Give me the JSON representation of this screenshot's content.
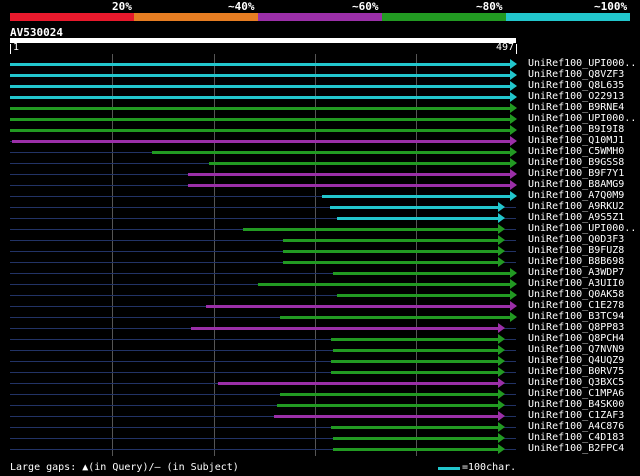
{
  "scale": {
    "labels": [
      "20%",
      "~40%",
      "~60%",
      "~80%",
      "~100%"
    ],
    "colors": [
      "#e8192c",
      "#e67d22",
      "#9b2fa8",
      "#229a22",
      "#22c6cc"
    ]
  },
  "query": {
    "name": "AV530024",
    "start": "1",
    "end": "497"
  },
  "hits": [
    {
      "name": "UniRef100_UPI000..",
      "color": "#22c6cc",
      "start": 1,
      "end": 497
    },
    {
      "name": "UniRef100_Q8VZF3",
      "color": "#22c6cc",
      "start": 1,
      "end": 497
    },
    {
      "name": "UniRef100_Q8L635",
      "color": "#22c6cc",
      "start": 1,
      "end": 497
    },
    {
      "name": "UniRef100_O22913",
      "color": "#22c6cc",
      "start": 1,
      "end": 497
    },
    {
      "name": "UniRef100_B9RNE4",
      "color": "#229a22",
      "start": 1,
      "end": 497
    },
    {
      "name": "UniRef100_UPI000..",
      "color": "#229a22",
      "start": 1,
      "end": 497
    },
    {
      "name": "UniRef100_B9I9I8",
      "color": "#229a22",
      "start": 1,
      "end": 497
    },
    {
      "name": "UniRef100_Q10MJ1",
      "color": "#9b2fa8",
      "start": 3,
      "end": 497
    },
    {
      "name": "UniRef100_C5WMH0",
      "color": "#229a22",
      "start": 140,
      "end": 497
    },
    {
      "name": "UniRef100_B9GSS8",
      "color": "#229a22",
      "start": 196,
      "end": 497
    },
    {
      "name": "UniRef100_B9F7Y1",
      "color": "#9b2fa8",
      "start": 175,
      "end": 497
    },
    {
      "name": "UniRef100_B8AMG9",
      "color": "#9b2fa8",
      "start": 175,
      "end": 497
    },
    {
      "name": "UniRef100_A7Q0M9",
      "color": "#22c6cc",
      "start": 307,
      "end": 497
    },
    {
      "name": "UniRef100_A9RKU2",
      "color": "#22c6cc",
      "start": 315,
      "end": 485
    },
    {
      "name": "UniRef100_A9S5Z1",
      "color": "#22c6cc",
      "start": 322,
      "end": 485
    },
    {
      "name": "UniRef100_UPI000..",
      "color": "#229a22",
      "start": 229,
      "end": 485
    },
    {
      "name": "UniRef100_Q0D3F3",
      "color": "#229a22",
      "start": 269,
      "end": 485
    },
    {
      "name": "UniRef100_B9FUZ8",
      "color": "#229a22",
      "start": 269,
      "end": 485
    },
    {
      "name": "UniRef100_B8B698",
      "color": "#229a22",
      "start": 269,
      "end": 485
    },
    {
      "name": "UniRef100_A3WDP7",
      "color": "#229a22",
      "start": 318,
      "end": 497
    },
    {
      "name": "UniRef100_A3UII0",
      "color": "#229a22",
      "start": 244,
      "end": 497
    },
    {
      "name": "UniRef100_Q0AK58",
      "color": "#229a22",
      "start": 322,
      "end": 497
    },
    {
      "name": "UniRef100_C1E278",
      "color": "#9b2fa8",
      "start": 193,
      "end": 497
    },
    {
      "name": "UniRef100_B3TC94",
      "color": "#229a22",
      "start": 266,
      "end": 497
    },
    {
      "name": "UniRef100_Q8PP83",
      "color": "#9b2fa8",
      "start": 178,
      "end": 485
    },
    {
      "name": "UniRef100_Q8PCH4",
      "color": "#229a22",
      "start": 316,
      "end": 485
    },
    {
      "name": "UniRef100_Q7NVN9",
      "color": "#229a22",
      "start": 318,
      "end": 485
    },
    {
      "name": "UniRef100_Q4UQZ9",
      "color": "#229a22",
      "start": 316,
      "end": 485
    },
    {
      "name": "UniRef100_B0RV75",
      "color": "#229a22",
      "start": 316,
      "end": 485
    },
    {
      "name": "UniRef100_Q3BXC5",
      "color": "#9b2fa8",
      "start": 205,
      "end": 485
    },
    {
      "name": "UniRef100_C1MPA6",
      "color": "#229a22",
      "start": 266,
      "end": 485
    },
    {
      "name": "UniRef100_B4SK00",
      "color": "#229a22",
      "start": 263,
      "end": 485
    },
    {
      "name": "UniRef100_C1ZAF3",
      "color": "#9b2fa8",
      "start": 260,
      "end": 485
    },
    {
      "name": "UniRef100_A4C876",
      "color": "#229a22",
      "start": 316,
      "end": 485
    },
    {
      "name": "UniRef100_C4D183",
      "color": "#229a22",
      "start": 318,
      "end": 485
    },
    {
      "name": "UniRef100_B2FPC4",
      "color": "#229a22",
      "start": 318,
      "end": 485
    }
  ],
  "footer": {
    "text": "Large gaps: ▲(in Query)/– (in Subject)",
    "legend": "=100char."
  }
}
